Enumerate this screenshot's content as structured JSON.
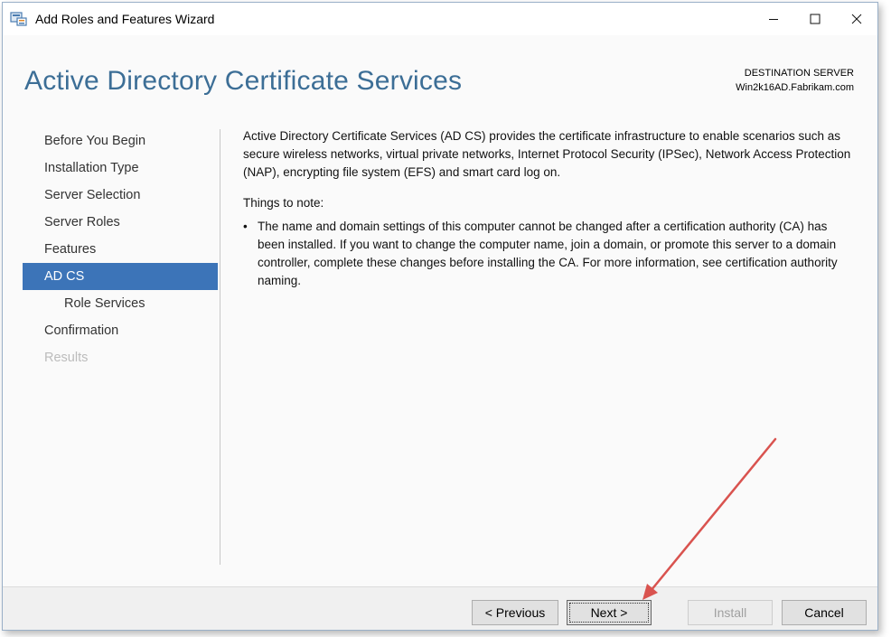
{
  "window": {
    "title": "Add Roles and Features Wizard"
  },
  "header": {
    "page_title": "Active Directory Certificate Services",
    "destination_label": "DESTINATION SERVER",
    "destination_server": "Win2k16AD.Fabrikam.com"
  },
  "nav": {
    "items": [
      {
        "label": "Before You Begin"
      },
      {
        "label": "Installation Type"
      },
      {
        "label": "Server Selection"
      },
      {
        "label": "Server Roles"
      },
      {
        "label": "Features"
      },
      {
        "label": "AD CS"
      },
      {
        "label": "Role Services"
      },
      {
        "label": "Confirmation"
      },
      {
        "label": "Results"
      }
    ]
  },
  "content": {
    "intro": "Active Directory Certificate Services (AD CS) provides the certificate infrastructure to enable scenarios such as secure wireless networks, virtual private networks, Internet Protocol Security (IPSec), Network Access Protection (NAP), encrypting file system (EFS) and smart card log on.",
    "notes_heading": "Things to note:",
    "bullet_char": "•",
    "bullet_1": "The name and domain settings of this computer cannot be changed after a certification authority (CA) has been installed. If you want to change the computer name, join a domain, or promote this server to a domain controller, complete these changes before installing the CA. For more information, see certification authority naming."
  },
  "footer": {
    "previous_label": "< Previous",
    "next_label": "Next >",
    "install_label": "Install",
    "cancel_label": "Cancel"
  },
  "colors": {
    "title_blue": "#3c6e96",
    "nav_active": "#3c74b8",
    "annotation_arrow": "#d9534f"
  },
  "icons": {
    "app": "server-manager-icon",
    "minimize": "minimize-icon",
    "maximize": "maximize-icon",
    "close": "close-icon"
  }
}
